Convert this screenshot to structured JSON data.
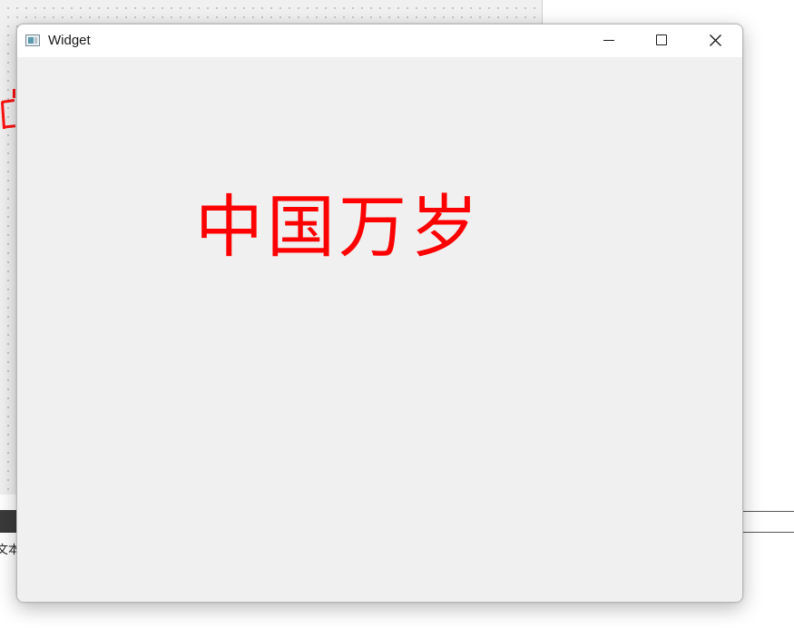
{
  "background": {
    "bottom_label": "文本",
    "canvas_fragment_color": "#ff1010"
  },
  "window": {
    "title": "Widget",
    "icon": "app-window-icon",
    "controls": {
      "minimize_icon": "minimize-icon",
      "maximize_icon": "maximize-icon",
      "close_icon": "close-icon"
    }
  },
  "content": {
    "text": "中国万岁",
    "text_color": "#ff0000",
    "background_color": "#f0f0f0"
  }
}
